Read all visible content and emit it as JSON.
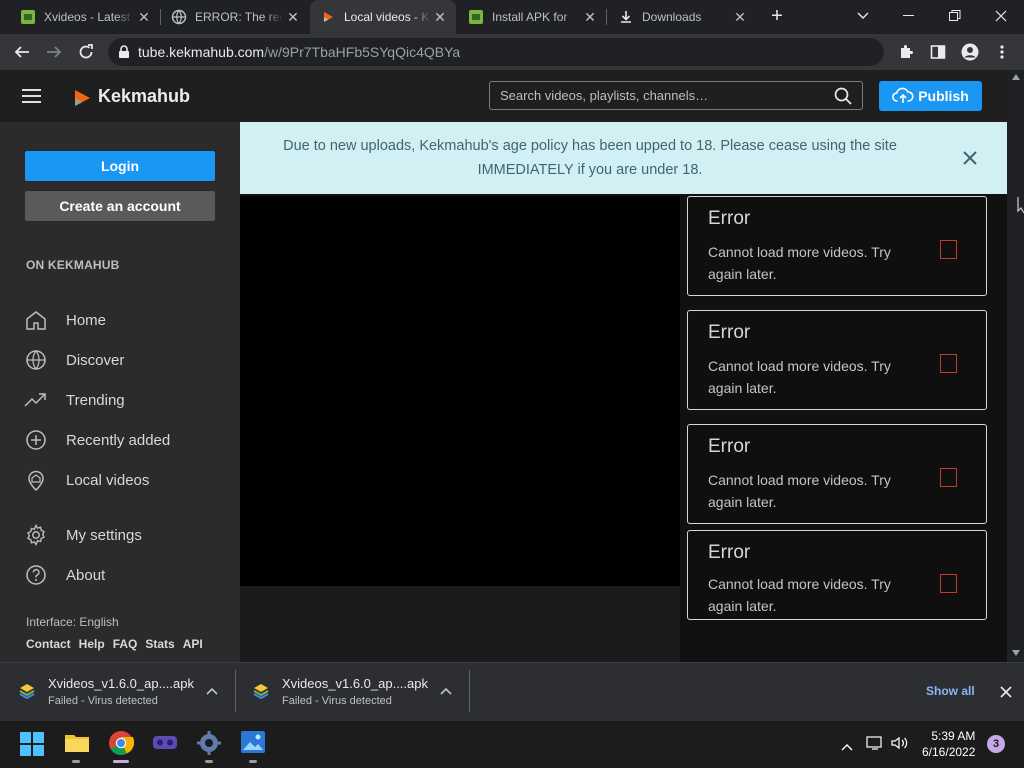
{
  "browser": {
    "tabs": [
      {
        "label": "Xvideos - Latest",
        "icon": "android-favicon-icon"
      },
      {
        "label": "ERROR: The req",
        "icon": "globe-icon"
      },
      {
        "label": "Local videos - K",
        "icon": "kekmahub-favicon-icon",
        "active": true
      },
      {
        "label": "Install APK for",
        "icon": "android-favicon-icon"
      },
      {
        "label": "Downloads",
        "icon": "download-icon"
      }
    ],
    "url_host": "tube.kekmahub.com",
    "url_path": "/w/9Pr7TbaHFb5SYqQic4QBYa"
  },
  "site": {
    "brand": "Kekmahub",
    "search_placeholder": "Search videos, playlists, channels…",
    "publish_label": "Publish",
    "accent": "#1a97f2"
  },
  "sidebar": {
    "login_label": "Login",
    "create_label": "Create an account",
    "section_label": "ON KEKMAHUB",
    "items": [
      {
        "label": "Home",
        "icon": "home-icon"
      },
      {
        "label": "Discover",
        "icon": "globe-icon"
      },
      {
        "label": "Trending",
        "icon": "trending-icon"
      },
      {
        "label": "Recently added",
        "icon": "plus-circle-icon"
      },
      {
        "label": "Local videos",
        "icon": "location-icon"
      },
      {
        "label": "My settings",
        "icon": "gear-icon"
      },
      {
        "label": "About",
        "icon": "help-icon"
      }
    ],
    "interface_label": "Interface: English",
    "footer_links": [
      "Contact",
      "Help",
      "FAQ",
      "Stats",
      "API"
    ]
  },
  "banner": {
    "text": "Due to new uploads, Kekmahub's age policy has been upped to 18. Please cease using the site IMMEDIATELY if you are under 18."
  },
  "errors": [
    {
      "title": "Error",
      "message": "Cannot load more videos. Try again later."
    },
    {
      "title": "Error",
      "message": "Cannot load more videos. Try again later."
    },
    {
      "title": "Error",
      "message": "Cannot load more videos. Try again later."
    },
    {
      "title": "Error",
      "message": "Cannot load more videos. Try again later."
    }
  ],
  "downloads": [
    {
      "name": "Xvideos_v1.6.0_ap....apk",
      "status": "Failed - Virus detected"
    },
    {
      "name": "Xvideos_v1.6.0_ap....apk",
      "status": "Failed - Virus detected"
    }
  ],
  "show_all_label": "Show all",
  "taskbar": {
    "time": "5:39 AM",
    "date": "6/16/2022",
    "notifications": "3"
  }
}
